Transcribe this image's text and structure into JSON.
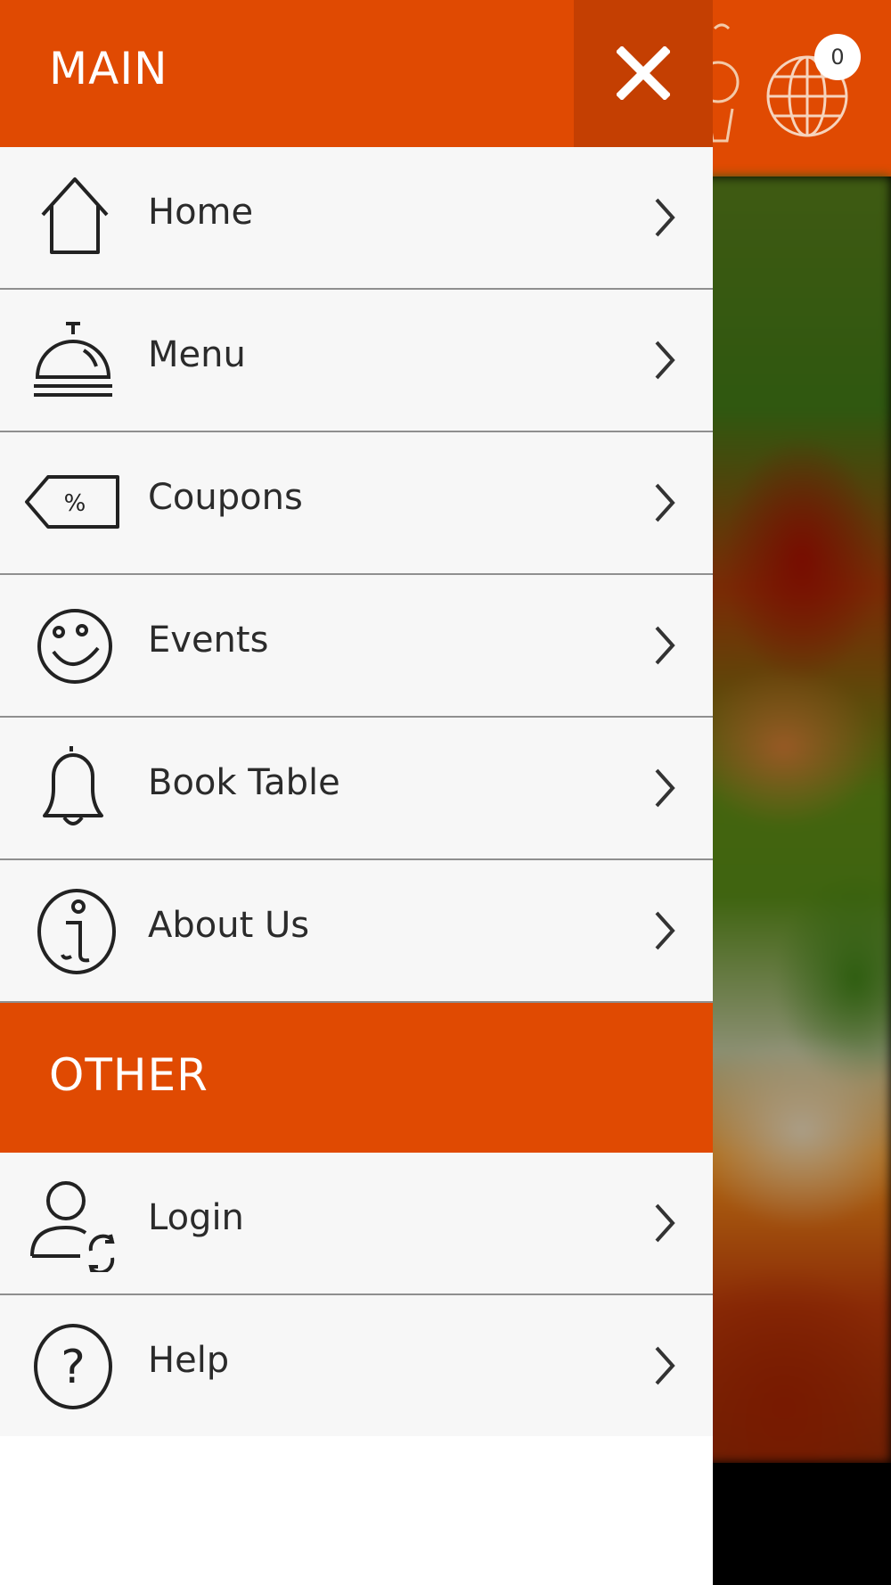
{
  "background": {
    "cart_badge_count": "0",
    "globe_badge_count": "0",
    "colors": {
      "brand": "#e04a02"
    }
  },
  "drawer": {
    "main_section": {
      "title": "MAIN",
      "close_icon": "close-icon"
    },
    "main_items": [
      {
        "label": "Home",
        "icon": "home-icon"
      },
      {
        "label": "Menu",
        "icon": "service-bell-icon"
      },
      {
        "label": "Coupons",
        "icon": "percent-tag-icon"
      },
      {
        "label": "Events",
        "icon": "smiley-icon"
      },
      {
        "label": "Book Table",
        "icon": "bell-icon"
      },
      {
        "label": "About Us",
        "icon": "info-icon"
      }
    ],
    "other_section": {
      "title": "OTHER"
    },
    "other_items": [
      {
        "label": "Login",
        "icon": "user-sync-icon"
      },
      {
        "label": "Help",
        "icon": "help-icon"
      }
    ]
  }
}
